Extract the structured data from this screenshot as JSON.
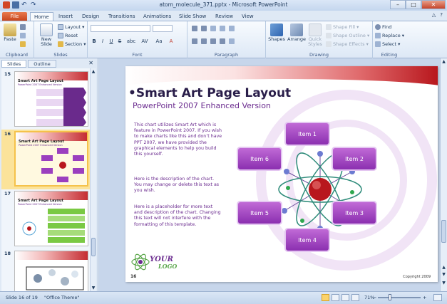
{
  "titlebar": {
    "title": "atom_molecule_371.pptx - Microsoft PowerPoint",
    "minimize": "–",
    "maximize": "□",
    "close": "✕",
    "undo": "↶",
    "redo": "↷"
  },
  "tabs": [
    {
      "label": "File"
    },
    {
      "label": "Home"
    },
    {
      "label": "Insert"
    },
    {
      "label": "Design"
    },
    {
      "label": "Transitions"
    },
    {
      "label": "Animations"
    },
    {
      "label": "Slide Show"
    },
    {
      "label": "Review"
    },
    {
      "label": "View"
    }
  ],
  "help": {
    "caret": "△",
    "help": "?"
  },
  "ribbon": {
    "clipboard": {
      "label": "Clipboard",
      "paste": "Paste"
    },
    "slides": {
      "label": "Slides",
      "new_slide": "New Slide",
      "layout": "Layout ▾",
      "reset": "Reset",
      "section": "Section ▾"
    },
    "font": {
      "label": "Font",
      "bold": "B",
      "italic": "I",
      "underline": "U",
      "strike": "S",
      "shadow": "abc",
      "spacing": "AV",
      "case": "Aa",
      "grow": "A",
      "shrink": "A",
      "clear": "A",
      "color": "A"
    },
    "paragraph": {
      "label": "Paragraph"
    },
    "drawing": {
      "label": "Drawing",
      "shapes": "Shapes",
      "arrange": "Arrange",
      "quick_styles": "Quick Styles",
      "shape_fill": "Shape Fill ▾",
      "shape_outline": "Shape Outline ▾",
      "shape_effects": "Shape Effects ▾"
    },
    "editing": {
      "label": "Editing",
      "find": "Find",
      "replace": "Replace ▾",
      "select": "Select ▾"
    }
  },
  "leftpane": {
    "tabs": [
      {
        "label": "Slides"
      },
      {
        "label": "Outline"
      }
    ],
    "close": "✕",
    "thumbnails": [
      {
        "number": "15",
        "title": "Smart Art Page Layout",
        "subtitle": "PowerPoint 2007 Enhanced Version"
      },
      {
        "number": "16",
        "title": "Smart Art Page Layout",
        "subtitle": "PowerPoint 2007 Enhanced Version"
      },
      {
        "number": "17",
        "title": "Smart Art Page Layout",
        "subtitle": "PowerPoint 2007 Enhanced Version"
      },
      {
        "number": "18",
        "title": "",
        "subtitle": ""
      }
    ]
  },
  "slide": {
    "title": "•Smart Art Page Layout",
    "subtitle": "PowerPoint 2007 Enhanced Version",
    "paragraphs": [
      "This chart utilizes Smart Art which is feature in PowerPoint 2007. If you wish to make charts like this and don’t have PPT 2007, we have provided the graphical elements to help you build this yourself.",
      "Here is the description of the chart. You may change or delete this text as you wish.",
      "Here is a placeholder for more text and description of the chart. Changing this text will not interfere with the formatting of this template."
    ],
    "items": [
      "Item 1",
      "Item 2",
      "Item 3",
      "Item 4",
      "Item 5",
      "Item  6"
    ],
    "number": "16",
    "copyright": "Copyright 2009",
    "logo_text_1": "YOUR",
    "logo_text_2": "LOGO"
  },
  "statusbar": {
    "slide_info": "Slide 16 of 19",
    "theme": "\"Office Theme\"",
    "zoom": "71%",
    "zoom_out": "−",
    "zoom_in": "+"
  },
  "colors": {
    "accent": "#6b2c8f",
    "item_fill": "#9b3fbf",
    "file_tab": "#d24726"
  }
}
